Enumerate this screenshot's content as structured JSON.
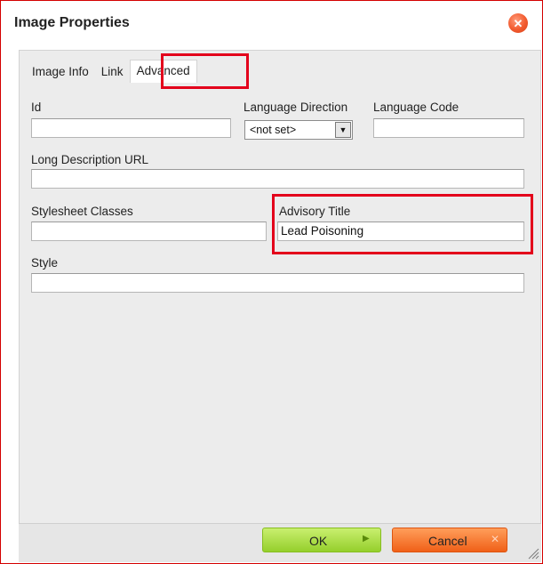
{
  "dialog": {
    "title": "Image Properties",
    "close_symbol": "✕"
  },
  "tabs": [
    {
      "label": "Image Info",
      "active": false
    },
    {
      "label": "Link",
      "active": false
    },
    {
      "label": "Advanced",
      "active": true
    }
  ],
  "fields": {
    "id": {
      "label": "Id",
      "value": ""
    },
    "language_direction": {
      "label": "Language Direction",
      "selected": "<not set>"
    },
    "language_code": {
      "label": "Language Code",
      "value": ""
    },
    "long_description_url": {
      "label": "Long Description URL",
      "value": ""
    },
    "stylesheet_classes": {
      "label": "Stylesheet Classes",
      "value": ""
    },
    "advisory_title": {
      "label": "Advisory Title",
      "value": "Lead Poisoning"
    },
    "style": {
      "label": "Style",
      "value": ""
    }
  },
  "footer": {
    "ok_label": "OK",
    "ok_icon": "chevron-right-icon",
    "cancel_label": "Cancel",
    "cancel_icon": "close-icon"
  },
  "colors": {
    "highlight": "#e3001b",
    "ok_button": "#a6dc3a",
    "cancel_button": "#f57a2f"
  }
}
